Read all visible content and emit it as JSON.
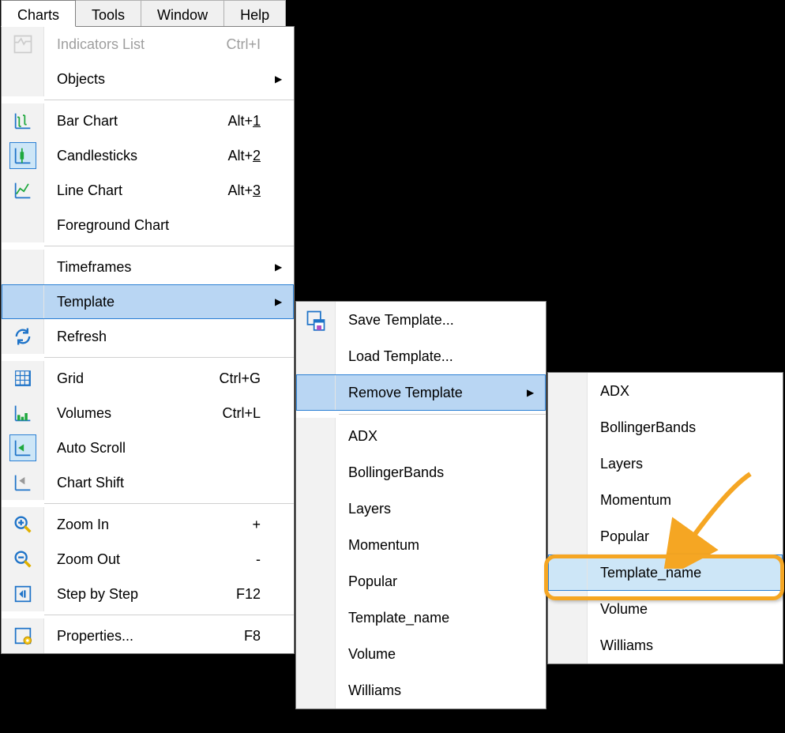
{
  "menubar": {
    "active": "Charts",
    "items": [
      {
        "label": "Charts"
      },
      {
        "label": "Tools"
      },
      {
        "label": "Window"
      },
      {
        "label": "Help"
      }
    ]
  },
  "charts_menu": {
    "indicators": {
      "label": "Indicators List",
      "shortcut": "Ctrl+I",
      "disabled": true
    },
    "objects": {
      "label": "Objects",
      "submenu": true
    },
    "bar_chart": {
      "label": "Bar Chart",
      "shortcut_prefix": "Alt+",
      "shortcut_key": "1"
    },
    "candlesticks": {
      "label": "Candlesticks",
      "shortcut_prefix": "Alt+",
      "shortcut_key": "2",
      "selected": true
    },
    "line_chart": {
      "label": "Line Chart",
      "shortcut_prefix": "Alt+",
      "shortcut_key": "3"
    },
    "foreground": {
      "label": "Foreground Chart"
    },
    "timeframes": {
      "label": "Timeframes",
      "submenu": true
    },
    "template": {
      "label": "Template",
      "submenu": true,
      "highlighted": true
    },
    "refresh": {
      "label": "Refresh"
    },
    "grid": {
      "label": "Grid",
      "shortcut": "Ctrl+G"
    },
    "volumes": {
      "label": "Volumes",
      "shortcut": "Ctrl+L"
    },
    "auto_scroll": {
      "label": "Auto Scroll",
      "selected": true
    },
    "chart_shift": {
      "label": "Chart Shift"
    },
    "zoom_in": {
      "label": "Zoom In",
      "shortcut": "+"
    },
    "zoom_out": {
      "label": "Zoom Out",
      "shortcut": "-"
    },
    "step": {
      "label": "Step by Step",
      "shortcut": "F12"
    },
    "properties": {
      "label": "Properties...",
      "shortcut": "F8"
    }
  },
  "template_menu": {
    "save": {
      "label": "Save Template..."
    },
    "load": {
      "label": "Load Template..."
    },
    "remove": {
      "label": "Remove Template",
      "submenu": true,
      "highlighted": true
    },
    "presets": [
      "ADX",
      "BollingerBands",
      "Layers",
      "Momentum",
      "Popular",
      "Template_name",
      "Volume",
      "Williams"
    ]
  },
  "remove_menu": {
    "items": [
      "ADX",
      "BollingerBands",
      "Layers",
      "Momentum",
      "Popular",
      "Template_name",
      "Volume",
      "Williams"
    ],
    "selected": "Template_name"
  },
  "callout_target": "Template_name"
}
